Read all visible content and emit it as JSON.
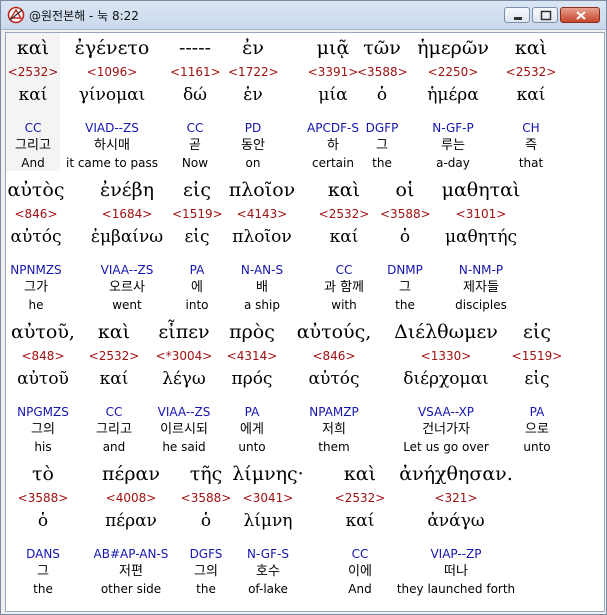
{
  "window": {
    "title": "@원전본해 - 눅 8:22",
    "icon": "app-logo-icon",
    "controls": [
      "minimize-icon",
      "maximize-icon",
      "close-icon"
    ]
  },
  "lines": [
    [
      {
        "word": "καὶ",
        "num": "<2532>",
        "lexeme": "καί",
        "morph": "CC",
        "korean": "그리고",
        "english": "And",
        "selected": true
      },
      {
        "word": "ἐγένετο",
        "num": "<1096>",
        "lexeme": "γίνομαι",
        "morph": "VIAD--ZS",
        "korean": "하시매",
        "english": "it came to pass"
      },
      {
        "word": "-----",
        "num": "<1161>",
        "lexeme": "δώ",
        "morph": "CC",
        "korean": "곧",
        "english": "Now"
      },
      {
        "word": "ἐν",
        "num": "<1722>",
        "lexeme": "ἐν",
        "morph": "PD",
        "korean": "동안",
        "english": "on"
      },
      {
        "word": "μιᾷ",
        "num": "<3391>",
        "lexeme": "μία",
        "morph": "APCDF-S",
        "korean": "하",
        "english": "certain"
      },
      {
        "word": "τῶν",
        "num": "<3588>",
        "lexeme": "ὁ",
        "morph": "DGFP",
        "korean": "그",
        "english": "the"
      },
      {
        "word": "ἡμερῶν",
        "num": "<2250>",
        "lexeme": "ἡμέρα",
        "morph": "N-GF-P",
        "korean": "루는",
        "english": "a-day"
      },
      {
        "word": "καὶ",
        "num": "<2532>",
        "lexeme": "καί",
        "morph": "CH",
        "korean": "즉",
        "english": "that"
      }
    ],
    [
      {
        "word": "αὐτὸς",
        "num": "<846>",
        "lexeme": "αὐτός",
        "morph": "NPNMZS",
        "korean": "그가",
        "english": "he"
      },
      {
        "word": "ἐνέβη",
        "num": "<1684>",
        "lexeme": "ἐμβαίνω",
        "morph": "VIAA--ZS",
        "korean": "오르사",
        "english": "went"
      },
      {
        "word": "εἰς",
        "num": "<1519>",
        "lexeme": "εἰς",
        "morph": "PA",
        "korean": "에",
        "english": "into"
      },
      {
        "word": "πλοῖον",
        "num": "<4143>",
        "lexeme": "πλοῖον",
        "morph": "N-AN-S",
        "korean": "배",
        "english": "a ship"
      },
      {
        "word": "καὶ",
        "num": "<2532>",
        "lexeme": "καί",
        "morph": "CC",
        "korean": "과 함께",
        "english": "with"
      },
      {
        "word": "οἱ",
        "num": "<3588>",
        "lexeme": "ὁ",
        "morph": "DNMP",
        "korean": "그",
        "english": "the"
      },
      {
        "word": "μαθηταὶ",
        "num": "<3101>",
        "lexeme": "μαθητής",
        "morph": "N-NM-P",
        "korean": "제자들",
        "english": "disciples"
      }
    ],
    [
      {
        "word": "αὐτοῦ,",
        "num": "<848>",
        "lexeme": "αὐτοῦ",
        "morph": "NPGMZS",
        "korean": "그의",
        "english": "his"
      },
      {
        "word": "καὶ",
        "num": "<2532>",
        "lexeme": "καί",
        "morph": "CC",
        "korean": "그리고",
        "english": "and"
      },
      {
        "word": "εἶπεν",
        "num": "<*3004>",
        "lexeme": "λέγω",
        "morph": "VIAA--ZS",
        "korean": "이르시되",
        "english": "he said"
      },
      {
        "word": "πρὸς",
        "num": "<4314>",
        "lexeme": "πρός",
        "morph": "PA",
        "korean": "에게",
        "english": "unto"
      },
      {
        "word": "αὐτούς,",
        "num": "<846>",
        "lexeme": "αὐτός",
        "morph": "NPAMZP",
        "korean": "저희",
        "english": "them"
      },
      {
        "word": "Διέλθωμεν",
        "num": "<1330>",
        "lexeme": "διέρχομαι",
        "morph": "VSAA--XP",
        "korean": "건너가자",
        "english": "Let us go over"
      },
      {
        "word": "εἰς",
        "num": "<1519>",
        "lexeme": "εἰς",
        "morph": "PA",
        "korean": "으로",
        "english": "unto"
      }
    ],
    [
      {
        "word": "τὸ",
        "num": "<3588>",
        "lexeme": "ὁ",
        "morph": "DANS",
        "korean": "그",
        "english": "the"
      },
      {
        "word": "πέραν",
        "num": "<4008>",
        "lexeme": "πέραν",
        "morph": "AB#AP-AN-S",
        "korean": "저편",
        "english": "other side"
      },
      {
        "word": "τῆς",
        "num": "<3588>",
        "lexeme": "ὁ",
        "morph": "DGFS",
        "korean": "그의",
        "english": "the"
      },
      {
        "word": "λίμνης·",
        "num": "<3041>",
        "lexeme": "λίμνη",
        "morph": "N-GF-S",
        "korean": "호수",
        "english": "of-lake"
      },
      {
        "word": "καὶ",
        "num": "<2532>",
        "lexeme": "καί",
        "morph": "CC",
        "korean": "이에",
        "english": "And"
      },
      {
        "word": "ἀνήχθησαν.",
        "num": "<321>",
        "lexeme": "ἀνάγω",
        "morph": "VIAP--ZP",
        "korean": "떠나",
        "english": "they launched forth"
      }
    ]
  ]
}
